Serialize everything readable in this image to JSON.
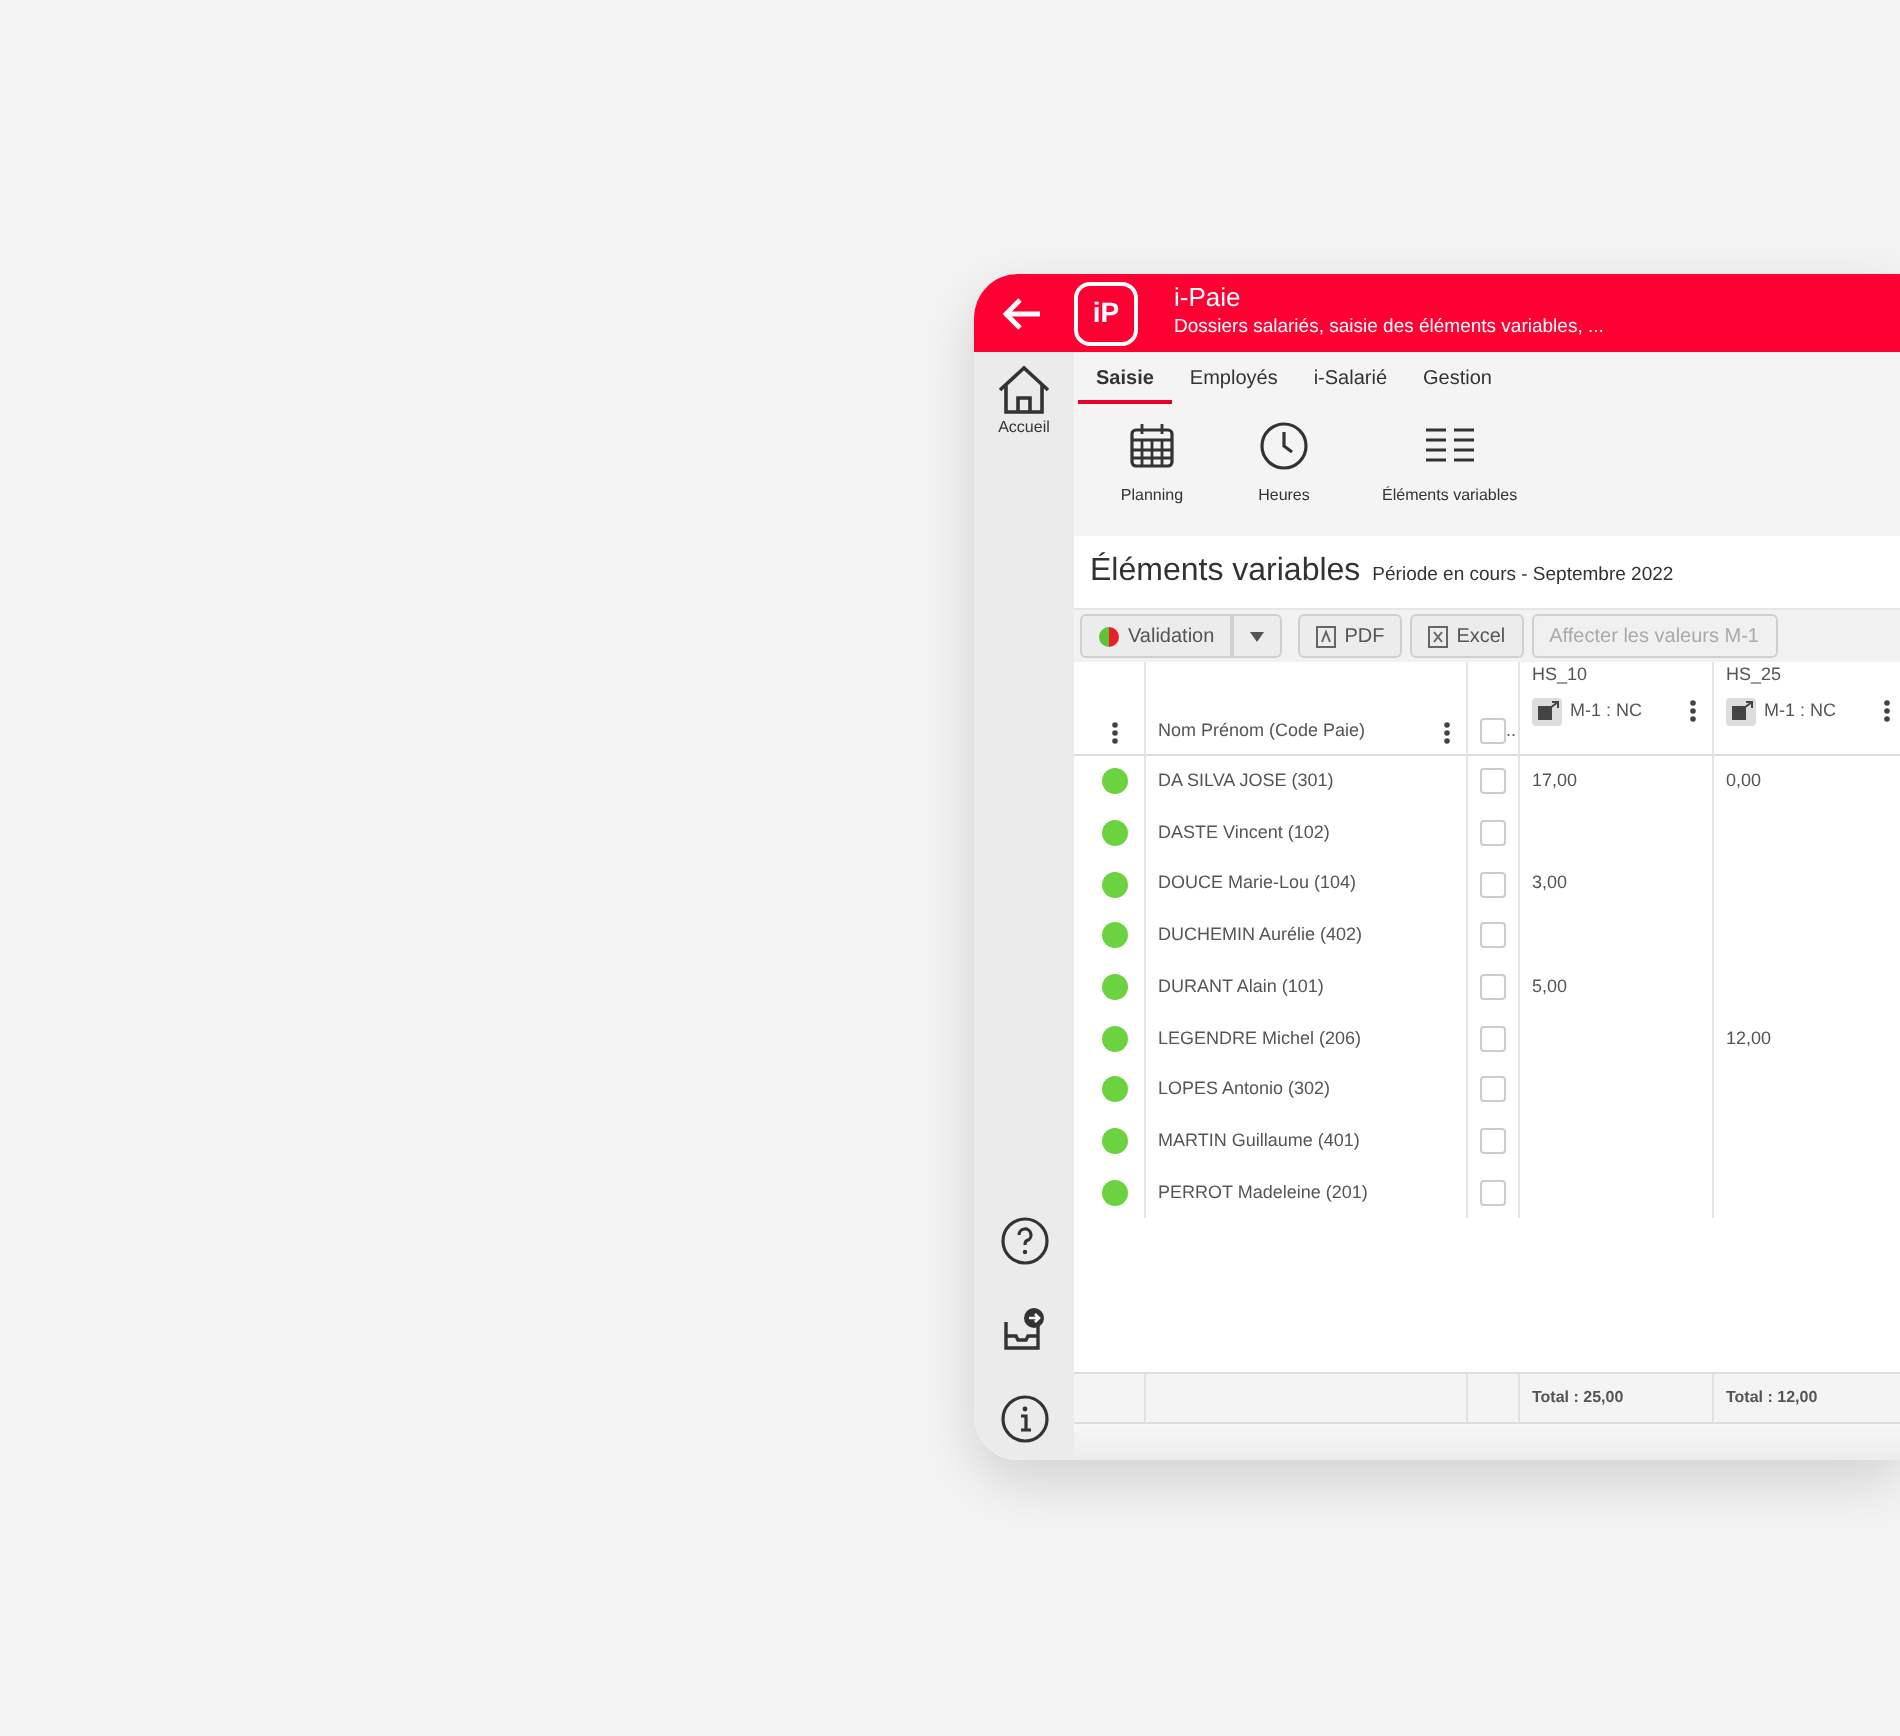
{
  "header": {
    "logo": "iP",
    "title": "i-Paie",
    "subtitle": "Dossiers salariés, saisie des éléments variables, ..."
  },
  "sidebar": {
    "home_label": "Accueil"
  },
  "tabs": [
    {
      "label": "Saisie",
      "selected": true
    },
    {
      "label": "Employés",
      "selected": false
    },
    {
      "label": "i-Salarié",
      "selected": false
    },
    {
      "label": "Gestion",
      "selected": false
    }
  ],
  "ribbon": [
    {
      "label": "Planning",
      "kind": "calendar"
    },
    {
      "label": "Heures",
      "kind": "clock"
    },
    {
      "label": "Éléments variables",
      "kind": "list"
    }
  ],
  "page": {
    "title": "Éléments variables",
    "period": "Période en cours - Septembre 2022"
  },
  "toolbar": [
    {
      "kind": "split",
      "label": "Validation",
      "disabled": false
    },
    {
      "kind": "pdf",
      "label": "PDF",
      "disabled": false
    },
    {
      "kind": "excel",
      "label": "Excel",
      "disabled": false
    },
    {
      "kind": "plain",
      "label": "Affecter les valeurs M-1",
      "disabled": true
    }
  ],
  "table": {
    "name_header": "Nom Prénom (Code Paie)",
    "check_header": {
      "label": "..",
      "checked": false
    },
    "value_columns": [
      {
        "code": "HS_10",
        "previous": "M-1 : NC",
        "total": "Total : 25,00"
      },
      {
        "code": "HS_25",
        "previous": "M-1 : NC",
        "total": "Total : 12,00"
      }
    ],
    "rows": [
      {
        "name": "DA SILVA JOSE (301)",
        "color": "#6bd33f",
        "checked": false,
        "hs_10": "17,00",
        "hs_25": "0,00"
      },
      {
        "name": "DASTE Vincent (102)",
        "color": "#6bd33f",
        "checked": false
      },
      {
        "name": "DOUCE Marie-Lou (104)",
        "color": "#6bd33f",
        "checked": false,
        "hs_10": "3,00"
      },
      {
        "name": "DUCHEMIN Aurélie (402)",
        "color": "#6bd33f",
        "checked": false
      },
      {
        "name": "DURANT Alain (101)",
        "color": "#6bd33f",
        "checked": false,
        "hs_10": "5,00"
      },
      {
        "name": "LEGENDRE Michel (206)",
        "color": "#6bd33f",
        "checked": false,
        "hs_25": "12,00"
      },
      {
        "name": "LOPES Antonio (302)",
        "color": "#6bd33f",
        "checked": false
      },
      {
        "name": "MARTIN Guillaume (401)",
        "color": "#6bd33f",
        "checked": false
      },
      {
        "name": "PERROT Madeleine (201)",
        "color": "#6bd33f",
        "checked": false
      }
    ]
  }
}
